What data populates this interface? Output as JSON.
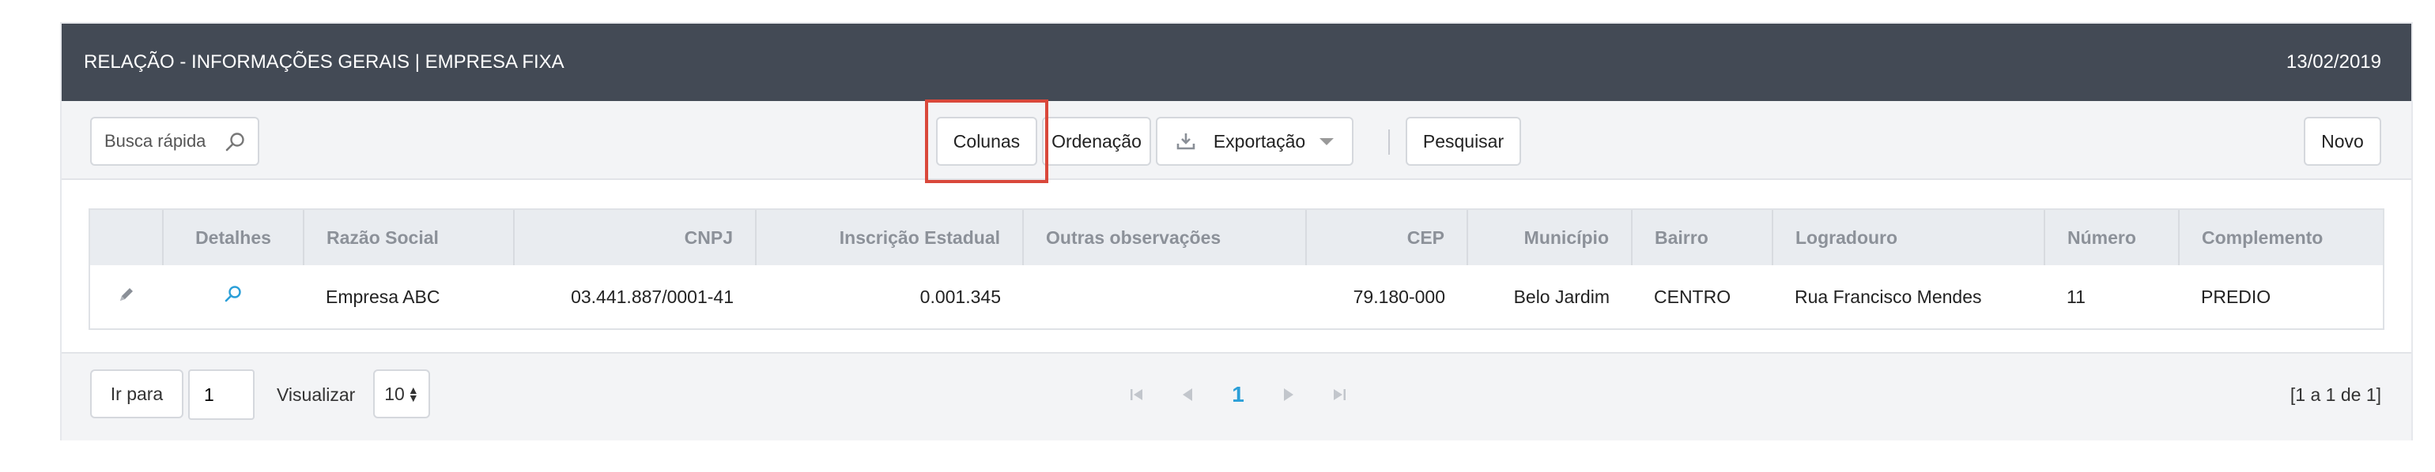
{
  "header": {
    "title": "RELAÇÃO - INFORMAÇÕES GERAIS | EMPRESA FIXA",
    "date": "13/02/2019"
  },
  "toolbar": {
    "search_placeholder": "Busca rápida",
    "columns_label": "Colunas",
    "order_label": "Ordenação",
    "export_label": "Exportação",
    "search_label": "Pesquisar",
    "new_label": "Novo"
  },
  "table": {
    "headers": [
      "",
      "Detalhes",
      "Razão Social",
      "CNPJ",
      "Inscrição Estadual",
      "Outras observações",
      "CEP",
      "Município",
      "Bairro",
      "Logradouro",
      "Número",
      "Complemento"
    ],
    "rows": [
      {
        "razao_social": "Empresa ABC",
        "cnpj": "03.441.887/0001-41",
        "inscricao": "0.001.345",
        "outras": "",
        "cep": "79.180-000",
        "municipio": "Belo Jardim",
        "bairro": "CENTRO",
        "logradouro": "Rua Francisco Mendes",
        "numero": "11",
        "complemento": "PREDIO"
      }
    ]
  },
  "footer": {
    "goto_label": "Ir para",
    "page_value": "1",
    "view_label": "Visualizar",
    "page_size": "10",
    "current_page": "1",
    "info": "[1 a 1 de 1]"
  },
  "colors": {
    "header_bg": "#434a55",
    "accent": "#2b9fd8",
    "highlight": "#d9483b"
  },
  "icons": [
    "search-icon",
    "download-icon",
    "edit-pencil-icon",
    "magnifier-icon",
    "first-page-icon",
    "prev-page-icon",
    "next-page-icon",
    "last-page-icon"
  ]
}
